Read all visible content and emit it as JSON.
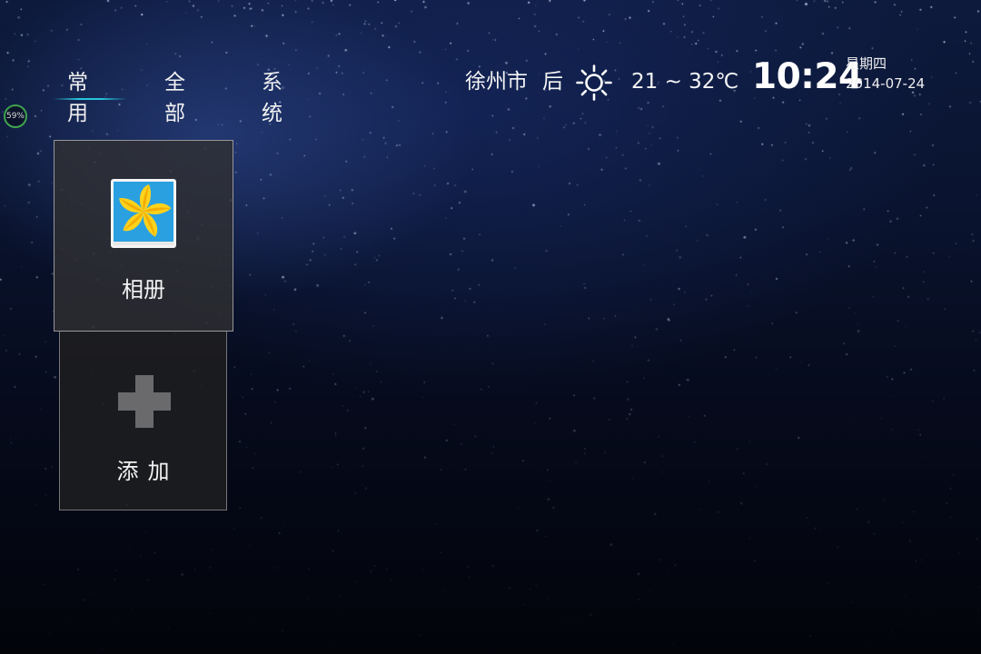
{
  "tabs": [
    {
      "label": "常用",
      "active": true
    },
    {
      "label": "全部",
      "active": false
    },
    {
      "label": "系统",
      "active": false
    }
  ],
  "memory": {
    "label": "59%"
  },
  "weather": {
    "city": "徐州市",
    "condition": "后",
    "icon": "sun-icon",
    "temperature": "21 ~ 32℃"
  },
  "clock": {
    "time": "10:24",
    "weekday": "星期四",
    "date": "2014-07-24"
  },
  "apps": [
    {
      "label": "相册",
      "icon": "photo-album-icon"
    },
    {
      "label": "添加",
      "icon": "plus-icon"
    }
  ],
  "colors": {
    "accent": "#27c6dc",
    "memory_ring": "#3fa34d",
    "tile_border": "#969696"
  }
}
